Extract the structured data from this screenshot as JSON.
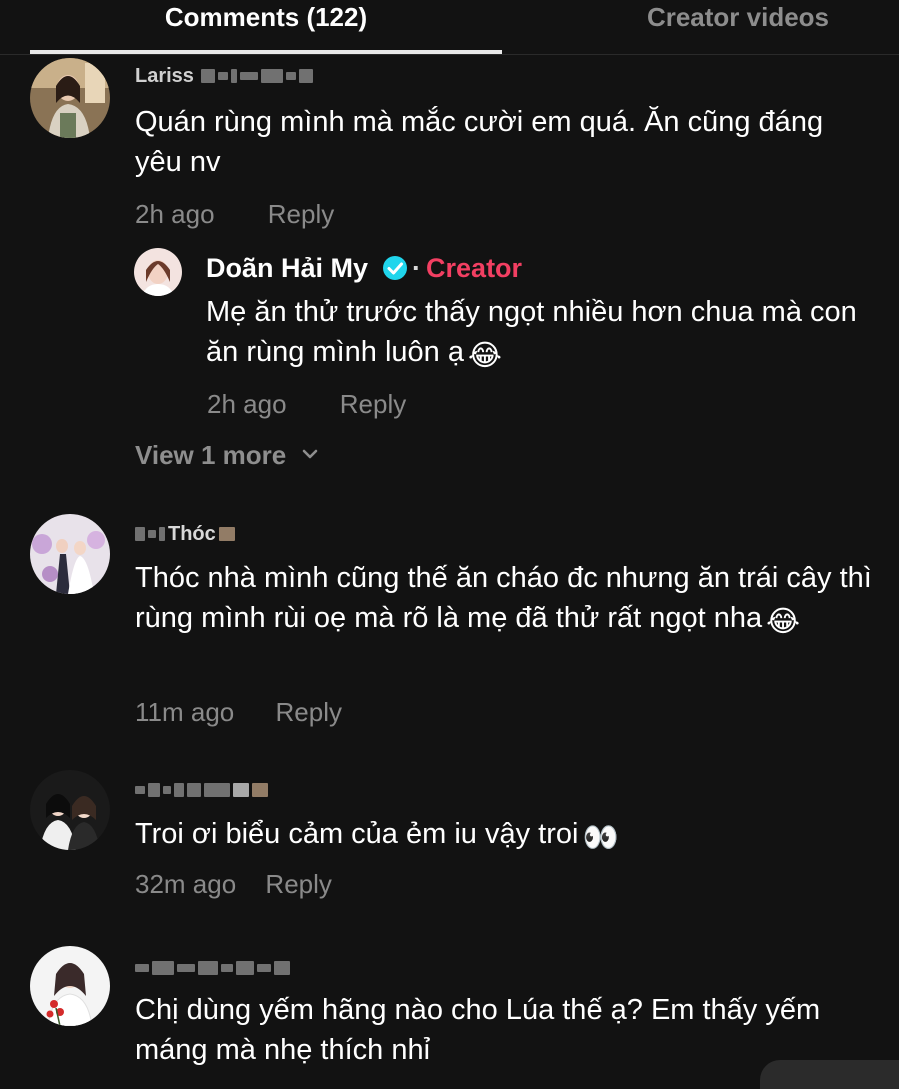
{
  "tabs": {
    "comments_label": "Comments (122)",
    "videos_label": "Creator videos"
  },
  "comments": [
    {
      "username": "Larissa",
      "text": "Quán rùng mình mà mắc cười em quá. Ăn cũng đáng yêu nv",
      "time": "2h ago",
      "reply_label": "Reply",
      "avatar": "woman-portrait-avatar"
    },
    {
      "username": "My Thóc",
      "text": "Thóc nhà mình cũng thế ăn cháo đc nhưng ăn trái cây thì rùng mình rùi oẹ mà rõ là mẹ đã thử rất ngọt nha",
      "emoji": "😂",
      "time": "11m ago",
      "reply_label": "Reply",
      "avatar": "wedding-couple-avatar"
    },
    {
      "username": "",
      "text": "Troi ơi biểu cảm của ẻm iu vậy troi",
      "emoji": "👀",
      "time": "32m ago",
      "reply_label": "Reply",
      "avatar": "two-girls-avatar"
    },
    {
      "username": "",
      "text": "Chị dùng yếm hãng nào cho Lúa thế ạ? Em thấy yếm máng mà nhẹ thích nhỉ",
      "time": "",
      "reply_label": "",
      "avatar": "woman-with-flowers-avatar"
    }
  ],
  "creator_reply": {
    "name": "Doãn Hải My",
    "badge": "Creator",
    "separator": "·",
    "text": "Mẹ ăn thử trước thấy ngọt nhiều hơn chua mà con ăn rùng mình luôn ạ",
    "emoji": "😂",
    "time": "2h ago",
    "reply_label": "Reply",
    "avatar": "creator-avatar",
    "verified_icon": "verified-check-icon"
  },
  "view_more": {
    "label": "View 1 more",
    "icon": "chevron-down-icon"
  },
  "colors": {
    "background": "#121212",
    "creator_badge": "#f23f62",
    "verified": "#20d5ec",
    "muted_text": "#8a8a8a"
  }
}
